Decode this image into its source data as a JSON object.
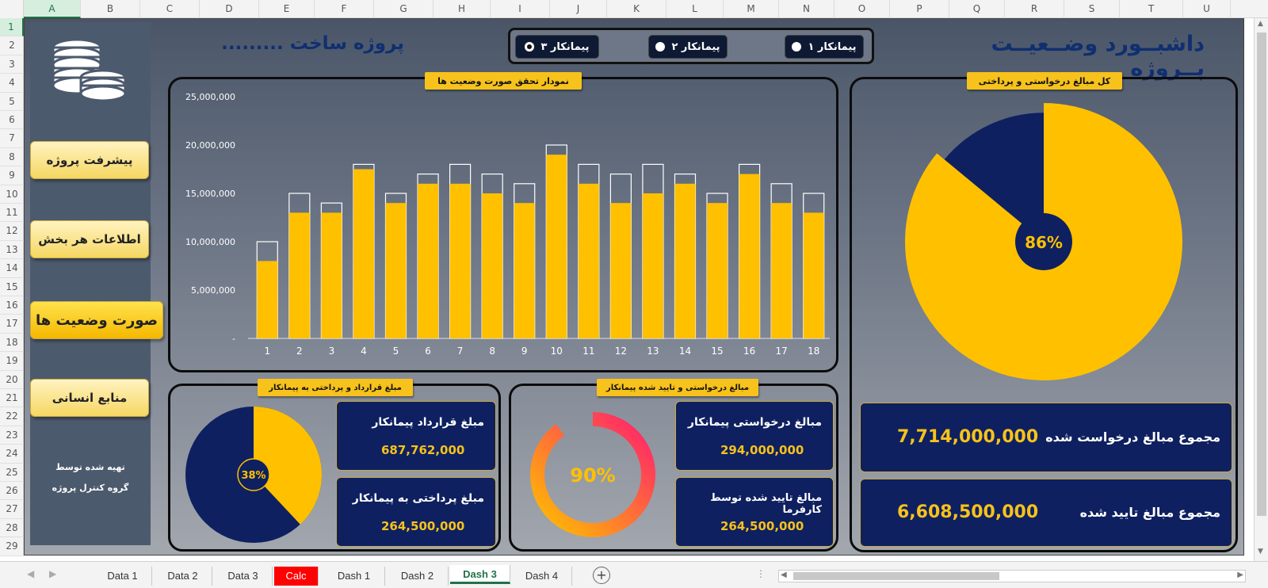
{
  "spreadsheet": {
    "columns": [
      "A",
      "B",
      "C",
      "D",
      "E",
      "F",
      "G",
      "H",
      "I",
      "J",
      "K",
      "L",
      "M",
      "N",
      "O",
      "P",
      "Q",
      "R",
      "S",
      "T",
      "U"
    ],
    "rows": [
      "1",
      "2",
      "3",
      "4",
      "5",
      "6",
      "7",
      "8",
      "9",
      "10",
      "11",
      "12",
      "13",
      "14",
      "15",
      "16",
      "17",
      "18",
      "19",
      "20",
      "21",
      "22",
      "23",
      "24",
      "25",
      "26",
      "27",
      "28",
      "29"
    ],
    "selected_cell": "A1"
  },
  "dashboard": {
    "main_title": "داشبــورد وضــعیــت پــروژه",
    "project_title": "پروژه ساخت .........",
    "contractor_options": [
      {
        "label": "پیمانکار ۱",
        "selected": false
      },
      {
        "label": "پیمانکار ۲",
        "selected": false
      },
      {
        "label": "پیمانکار ۳",
        "selected": true
      }
    ]
  },
  "sidebar": {
    "logo_icon": "coins-icon",
    "nav": [
      {
        "label": "پیشرفت پروژه",
        "active": false
      },
      {
        "label": "اطلاعات هر بخش",
        "active": false
      },
      {
        "label": "صورت وضعیت ها",
        "active": true
      },
      {
        "label": "منابع انسانی",
        "active": false
      }
    ],
    "credit_line1": "تهیه شده توسط",
    "credit_line2": "گروه کنترل پروژه"
  },
  "bar_panel": {
    "title": "نمودار تحقق صورت وضعیت ها"
  },
  "pie_panel": {
    "title": "کل مبالغ درخواستی و پرداختی",
    "center_label": "86%"
  },
  "contract_panel": {
    "title": "مبلغ قرارداد و پرداختی به پیمانکار",
    "center_label": "38%",
    "card1_label": "مبلغ قرارداد پیمانکار",
    "card1_value": "687,762,000",
    "card2_label": "مبلغ پرداختی به پیمانکار",
    "card2_value": "264,500,000"
  },
  "request_panel": {
    "title": "مبالغ درخواستی و تایید شده پیمانکار",
    "center_label": "90%",
    "card1_label": "مبالغ درخواستی پیمانکار",
    "card1_value": "294,000,000",
    "card2_label": "مبالغ تایید شده توسط کارفرما",
    "card2_value": "264,500,000"
  },
  "totals": {
    "requested_label": "مجموع مبالغ درخواست شده",
    "requested_value": "7,714,000,000",
    "approved_label": "مجموع مبالغ تایید شده",
    "approved_value": "6,608,500,000"
  },
  "colors": {
    "accent_yellow": "#ffc000",
    "navy": "#0e2060",
    "pink": "#ff1f6e",
    "title_blue": "#0f2f70"
  },
  "chart_data": [
    {
      "type": "bar",
      "title": "نمودار تحقق صورت وضعیت ها",
      "categories": [
        "1",
        "2",
        "3",
        "4",
        "5",
        "6",
        "7",
        "8",
        "9",
        "10",
        "11",
        "12",
        "13",
        "14",
        "15",
        "16",
        "17",
        "18"
      ],
      "series": [
        {
          "values": [
            8000000,
            13000000,
            13000000,
            17500000,
            14000000,
            16000000,
            16000000,
            15000000,
            14000000,
            19000000,
            16000000,
            14000000,
            15000000,
            16000000,
            14000000,
            17000000,
            14000000,
            13000000
          ]
        },
        {
          "values": [
            10000000,
            15000000,
            14000000,
            18000000,
            15000000,
            17000000,
            18000000,
            17000000,
            16000000,
            20000000,
            18000000,
            17000000,
            18000000,
            17000000,
            15000000,
            18000000,
            16000000,
            15000000
          ]
        }
      ],
      "yticks": [
        "25,000,000",
        "20,000,000",
        "15,000,000",
        "10,000,000",
        "5,000,000",
        "-"
      ],
      "ylim": [
        0,
        25000000
      ]
    },
    {
      "type": "pie",
      "title": "کل مبالغ درخواستی و پرداختی",
      "values": [
        86,
        14
      ],
      "center_label": "86%"
    },
    {
      "type": "pie",
      "title": "مبلغ قرارداد و پرداختی به پیمانکار",
      "values": [
        38,
        62
      ],
      "center_label": "38%"
    },
    {
      "type": "pie",
      "title": "مبالغ درخواستی و تایید شده پیمانکار",
      "values": [
        90,
        10
      ],
      "center_label": "90%"
    }
  ],
  "sheet_tabs": [
    {
      "label": "Data 1",
      "active": false,
      "red": false
    },
    {
      "label": "Data 2",
      "active": false,
      "red": false
    },
    {
      "label": "Data 3",
      "active": false,
      "red": false
    },
    {
      "label": "Calc",
      "active": false,
      "red": true
    },
    {
      "label": "Dash 1",
      "active": false,
      "red": false
    },
    {
      "label": "Dash 2",
      "active": false,
      "red": false
    },
    {
      "label": "Dash 3",
      "active": true,
      "red": false
    },
    {
      "label": "Dash 4",
      "active": false,
      "red": false
    }
  ],
  "add_sheet_symbol": "+"
}
